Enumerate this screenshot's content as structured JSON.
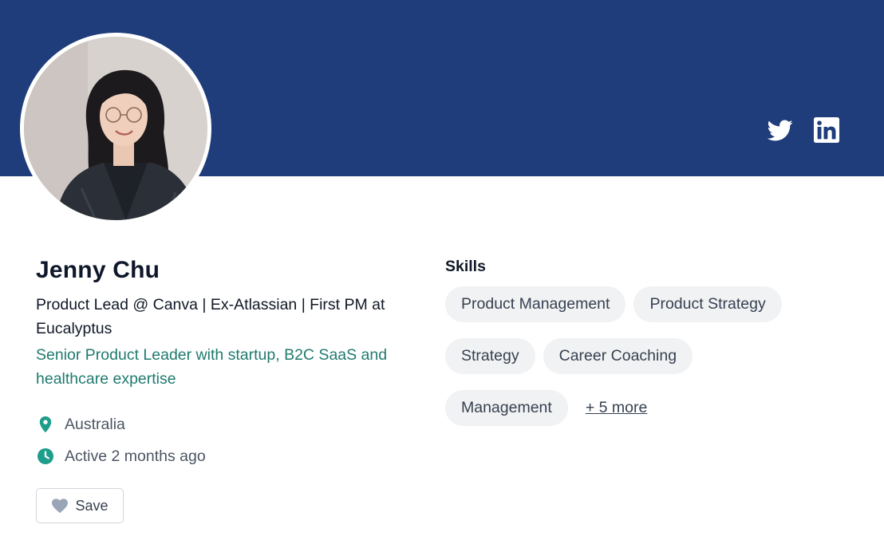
{
  "profile": {
    "name": "Jenny Chu",
    "headline": "Product Lead @ Canva | Ex-Atlassian | First PM at Eucalyptus",
    "tagline": "Senior Product Leader with startup, B2C SaaS and healthcare expertise",
    "location": "Australia",
    "activity": "Active 2 months ago",
    "save_label": "Save"
  },
  "social": {
    "icons": [
      "twitter-icon",
      "linkedin-icon"
    ]
  },
  "skills": {
    "title": "Skills",
    "items": [
      "Product Management",
      "Product Strategy",
      "Strategy",
      "Career Coaching",
      "Management"
    ],
    "more_label": "+ 5 more"
  },
  "colors": {
    "banner": "#1f3c7b",
    "accent_teal": "#1f7a6e",
    "chip_bg": "#f1f2f4"
  }
}
